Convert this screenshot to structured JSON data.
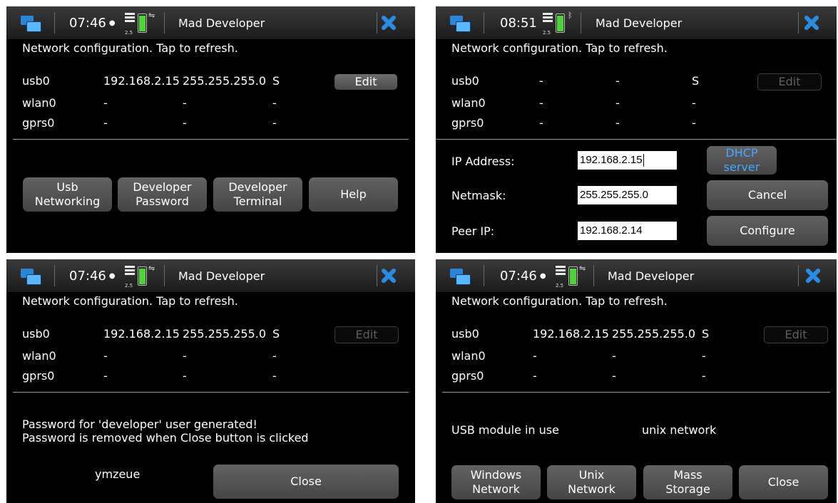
{
  "app_title": "Mad Developer",
  "caption": "Network configuration. Tap to refresh.",
  "colors": {
    "accent": "#2a8be0",
    "link_blue": "#46a7ff",
    "battery": "#4fd23b",
    "background": "#000000"
  },
  "icons": [
    "task-switcher-icon",
    "signal-icon",
    "battery-icon",
    "usb-icon",
    "bluetooth-icon",
    "close-icon"
  ],
  "network_gen": "2.5",
  "panels": [
    {
      "clock": "07:46",
      "conn_icon": "⇋",
      "edit_label": "Edit",
      "interfaces": [
        {
          "name": "usb0",
          "ip": "192.168.2.15",
          "mask": "255.255.255.0",
          "state": "S"
        },
        {
          "name": "wlan0",
          "ip": "-",
          "mask": "-",
          "state": "-"
        },
        {
          "name": "gprs0",
          "ip": "-",
          "mask": "-",
          "state": "-"
        }
      ],
      "buttons": {
        "usb": "Usb\nNetworking",
        "dev_password": "Developer\nPassword",
        "dev_terminal": "Developer\nTerminal",
        "help": "Help"
      }
    },
    {
      "clock": "08:51",
      "conn_icon": "ᛒ",
      "edit_label": "Edit",
      "interfaces": [
        {
          "name": "usb0",
          "ip": "-",
          "mask": "-",
          "state": "S"
        },
        {
          "name": "wlan0",
          "ip": "-",
          "mask": "-",
          "state": "-"
        },
        {
          "name": "gprs0",
          "ip": "-",
          "mask": "-",
          "state": "-"
        }
      ],
      "form": {
        "ip_label": "IP Address:",
        "ip_value": "192.168.2.15",
        "netmask_label": "Netmask:",
        "netmask_value": "255.255.255.0",
        "peer_label": "Peer IP:",
        "peer_value": "192.168.2.14"
      },
      "buttons": {
        "dhcp": "DHCP server",
        "cancel": "Cancel",
        "configure": "Configure"
      }
    },
    {
      "clock": "07:46",
      "conn_icon": "⇋",
      "edit_label": "Edit",
      "interfaces": [
        {
          "name": "usb0",
          "ip": "192.168.2.15",
          "mask": "255.255.255.0",
          "state": "S"
        },
        {
          "name": "wlan0",
          "ip": "-",
          "mask": "-",
          "state": "-"
        },
        {
          "name": "gprs0",
          "ip": "-",
          "mask": "-",
          "state": "-"
        }
      ],
      "message_line1": "Password for 'developer' user generated!",
      "message_line2": "Password is removed when Close button is clicked",
      "password": "ymzeue",
      "buttons": {
        "close": "Close"
      }
    },
    {
      "clock": "07:46",
      "conn_icon": "⇋",
      "edit_label": "Edit",
      "interfaces": [
        {
          "name": "usb0",
          "ip": "192.168.2.15",
          "mask": "255.255.255.0",
          "state": "S"
        },
        {
          "name": "wlan0",
          "ip": "-",
          "mask": "-",
          "state": "-"
        },
        {
          "name": "gprs0",
          "ip": "-",
          "mask": "-",
          "state": "-"
        }
      ],
      "usb_module_label": "USB module in use",
      "usb_module_value": "unix network",
      "buttons": {
        "windows": "Windows\nNetwork",
        "unix": "Unix\nNetwork",
        "mass": "Mass\nStorage",
        "close": "Close"
      }
    }
  ]
}
